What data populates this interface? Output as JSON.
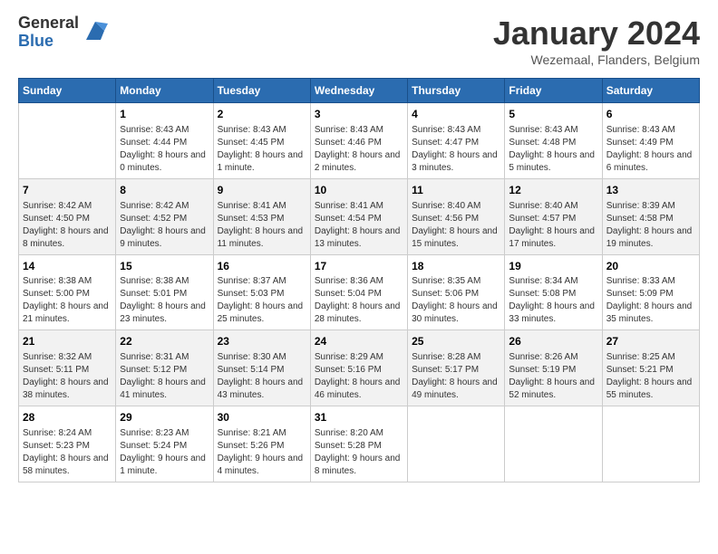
{
  "logo": {
    "general": "General",
    "blue": "Blue"
  },
  "header": {
    "title": "January 2024",
    "location": "Wezemaal, Flanders, Belgium"
  },
  "days": [
    "Sunday",
    "Monday",
    "Tuesday",
    "Wednesday",
    "Thursday",
    "Friday",
    "Saturday"
  ],
  "weeks": [
    [
      {
        "num": "",
        "sunrise": "",
        "sunset": "",
        "daylight": ""
      },
      {
        "num": "1",
        "sunrise": "Sunrise: 8:43 AM",
        "sunset": "Sunset: 4:44 PM",
        "daylight": "Daylight: 8 hours and 0 minutes."
      },
      {
        "num": "2",
        "sunrise": "Sunrise: 8:43 AM",
        "sunset": "Sunset: 4:45 PM",
        "daylight": "Daylight: 8 hours and 1 minute."
      },
      {
        "num": "3",
        "sunrise": "Sunrise: 8:43 AM",
        "sunset": "Sunset: 4:46 PM",
        "daylight": "Daylight: 8 hours and 2 minutes."
      },
      {
        "num": "4",
        "sunrise": "Sunrise: 8:43 AM",
        "sunset": "Sunset: 4:47 PM",
        "daylight": "Daylight: 8 hours and 3 minutes."
      },
      {
        "num": "5",
        "sunrise": "Sunrise: 8:43 AM",
        "sunset": "Sunset: 4:48 PM",
        "daylight": "Daylight: 8 hours and 5 minutes."
      },
      {
        "num": "6",
        "sunrise": "Sunrise: 8:43 AM",
        "sunset": "Sunset: 4:49 PM",
        "daylight": "Daylight: 8 hours and 6 minutes."
      }
    ],
    [
      {
        "num": "7",
        "sunrise": "Sunrise: 8:42 AM",
        "sunset": "Sunset: 4:50 PM",
        "daylight": "Daylight: 8 hours and 8 minutes."
      },
      {
        "num": "8",
        "sunrise": "Sunrise: 8:42 AM",
        "sunset": "Sunset: 4:52 PM",
        "daylight": "Daylight: 8 hours and 9 minutes."
      },
      {
        "num": "9",
        "sunrise": "Sunrise: 8:41 AM",
        "sunset": "Sunset: 4:53 PM",
        "daylight": "Daylight: 8 hours and 11 minutes."
      },
      {
        "num": "10",
        "sunrise": "Sunrise: 8:41 AM",
        "sunset": "Sunset: 4:54 PM",
        "daylight": "Daylight: 8 hours and 13 minutes."
      },
      {
        "num": "11",
        "sunrise": "Sunrise: 8:40 AM",
        "sunset": "Sunset: 4:56 PM",
        "daylight": "Daylight: 8 hours and 15 minutes."
      },
      {
        "num": "12",
        "sunrise": "Sunrise: 8:40 AM",
        "sunset": "Sunset: 4:57 PM",
        "daylight": "Daylight: 8 hours and 17 minutes."
      },
      {
        "num": "13",
        "sunrise": "Sunrise: 8:39 AM",
        "sunset": "Sunset: 4:58 PM",
        "daylight": "Daylight: 8 hours and 19 minutes."
      }
    ],
    [
      {
        "num": "14",
        "sunrise": "Sunrise: 8:38 AM",
        "sunset": "Sunset: 5:00 PM",
        "daylight": "Daylight: 8 hours and 21 minutes."
      },
      {
        "num": "15",
        "sunrise": "Sunrise: 8:38 AM",
        "sunset": "Sunset: 5:01 PM",
        "daylight": "Daylight: 8 hours and 23 minutes."
      },
      {
        "num": "16",
        "sunrise": "Sunrise: 8:37 AM",
        "sunset": "Sunset: 5:03 PM",
        "daylight": "Daylight: 8 hours and 25 minutes."
      },
      {
        "num": "17",
        "sunrise": "Sunrise: 8:36 AM",
        "sunset": "Sunset: 5:04 PM",
        "daylight": "Daylight: 8 hours and 28 minutes."
      },
      {
        "num": "18",
        "sunrise": "Sunrise: 8:35 AM",
        "sunset": "Sunset: 5:06 PM",
        "daylight": "Daylight: 8 hours and 30 minutes."
      },
      {
        "num": "19",
        "sunrise": "Sunrise: 8:34 AM",
        "sunset": "Sunset: 5:08 PM",
        "daylight": "Daylight: 8 hours and 33 minutes."
      },
      {
        "num": "20",
        "sunrise": "Sunrise: 8:33 AM",
        "sunset": "Sunset: 5:09 PM",
        "daylight": "Daylight: 8 hours and 35 minutes."
      }
    ],
    [
      {
        "num": "21",
        "sunrise": "Sunrise: 8:32 AM",
        "sunset": "Sunset: 5:11 PM",
        "daylight": "Daylight: 8 hours and 38 minutes."
      },
      {
        "num": "22",
        "sunrise": "Sunrise: 8:31 AM",
        "sunset": "Sunset: 5:12 PM",
        "daylight": "Daylight: 8 hours and 41 minutes."
      },
      {
        "num": "23",
        "sunrise": "Sunrise: 8:30 AM",
        "sunset": "Sunset: 5:14 PM",
        "daylight": "Daylight: 8 hours and 43 minutes."
      },
      {
        "num": "24",
        "sunrise": "Sunrise: 8:29 AM",
        "sunset": "Sunset: 5:16 PM",
        "daylight": "Daylight: 8 hours and 46 minutes."
      },
      {
        "num": "25",
        "sunrise": "Sunrise: 8:28 AM",
        "sunset": "Sunset: 5:17 PM",
        "daylight": "Daylight: 8 hours and 49 minutes."
      },
      {
        "num": "26",
        "sunrise": "Sunrise: 8:26 AM",
        "sunset": "Sunset: 5:19 PM",
        "daylight": "Daylight: 8 hours and 52 minutes."
      },
      {
        "num": "27",
        "sunrise": "Sunrise: 8:25 AM",
        "sunset": "Sunset: 5:21 PM",
        "daylight": "Daylight: 8 hours and 55 minutes."
      }
    ],
    [
      {
        "num": "28",
        "sunrise": "Sunrise: 8:24 AM",
        "sunset": "Sunset: 5:23 PM",
        "daylight": "Daylight: 8 hours and 58 minutes."
      },
      {
        "num": "29",
        "sunrise": "Sunrise: 8:23 AM",
        "sunset": "Sunset: 5:24 PM",
        "daylight": "Daylight: 9 hours and 1 minute."
      },
      {
        "num": "30",
        "sunrise": "Sunrise: 8:21 AM",
        "sunset": "Sunset: 5:26 PM",
        "daylight": "Daylight: 9 hours and 4 minutes."
      },
      {
        "num": "31",
        "sunrise": "Sunrise: 8:20 AM",
        "sunset": "Sunset: 5:28 PM",
        "daylight": "Daylight: 9 hours and 8 minutes."
      },
      {
        "num": "",
        "sunrise": "",
        "sunset": "",
        "daylight": ""
      },
      {
        "num": "",
        "sunrise": "",
        "sunset": "",
        "daylight": ""
      },
      {
        "num": "",
        "sunrise": "",
        "sunset": "",
        "daylight": ""
      }
    ]
  ]
}
